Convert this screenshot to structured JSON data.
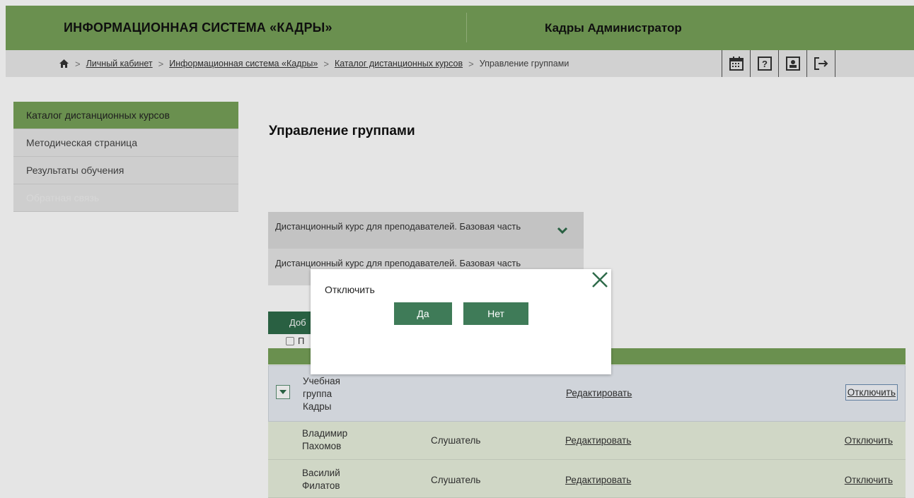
{
  "header": {
    "system_title": "ИНФОРМАЦИОННАЯ СИСТЕМА «КАДРЫ»",
    "user": "Кадры Администратор"
  },
  "breadcrumbs": {
    "items": [
      "Личный кабинет",
      "Информационная система «Кадры»",
      "Каталог дистанционных курсов"
    ],
    "current": "Управление группами",
    "separator": ">"
  },
  "toolbar": {
    "icons": [
      "calendar-icon",
      "help-icon",
      "profile-icon",
      "logout-icon"
    ]
  },
  "sidebar": {
    "items": [
      {
        "label": "Каталог дистанционных курсов",
        "state": "active"
      },
      {
        "label": "Методическая страница",
        "state": "normal"
      },
      {
        "label": "Результаты обучения",
        "state": "normal"
      },
      {
        "label": "Обратная связь",
        "state": "disabled"
      }
    ]
  },
  "main": {
    "title": "Управление группами",
    "course_select": {
      "selected": "Дистанционный курс для преподавателей. Базовая часть",
      "options": [
        "Дистанционный курс для преподавателей. Базовая часть"
      ]
    },
    "add_button_visible": "Доб",
    "checkbox_visible": "П"
  },
  "table": {
    "group": {
      "name_lines": [
        "Учебная",
        "группа",
        "Кадры"
      ],
      "edit": "Редактировать",
      "disable": "Отключить"
    },
    "members": [
      {
        "name_lines": [
          "Владимир",
          "Пахомов"
        ],
        "role": "Слушатель",
        "edit": "Редактировать",
        "disable": "Отключить"
      },
      {
        "name_lines": [
          "Василий",
          "Филатов"
        ],
        "role": "Слушатель",
        "edit": "Редактировать",
        "disable": "Отключить"
      }
    ]
  },
  "modal": {
    "message": "Отключить",
    "yes": "Да",
    "no": "Нет"
  },
  "colors": {
    "header_green": "#77a158",
    "button_green": "#3f7b58",
    "dark_green": "#2e6b4a"
  }
}
